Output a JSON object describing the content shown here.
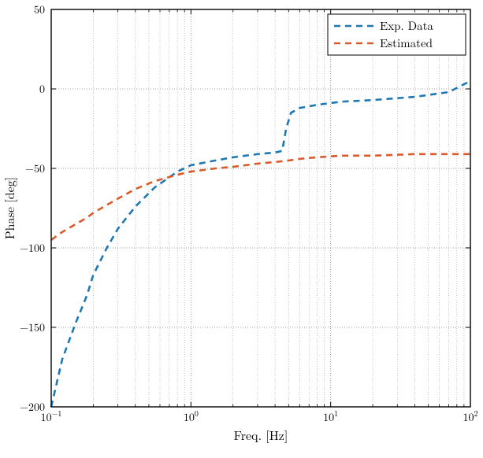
{
  "chart_data": {
    "type": "line",
    "xlabel": "Freq. [Hz]",
    "ylabel": "Phase [deg]",
    "xscale": "log",
    "xlim": [
      0.1,
      100
    ],
    "ylim": [
      -200,
      50
    ],
    "xticks_major": [
      0.1,
      1,
      10,
      100
    ],
    "xtick_labels": [
      "10^-1",
      "10^0",
      "10^1",
      "10^2"
    ],
    "yticks_major": [
      -200,
      -150,
      -100,
      -50,
      0,
      50
    ],
    "grid": true,
    "legend_position": "top-right",
    "series": [
      {
        "name": "Exp. Data",
        "color": "#1f77b4",
        "dash": "8,6",
        "x": [
          0.1,
          0.12,
          0.15,
          0.18,
          0.2,
          0.25,
          0.3,
          0.4,
          0.55,
          0.8,
          1.0,
          1.5,
          2.0,
          3.0,
          4.0,
          4.5,
          4.8,
          5.2,
          6.0,
          8.0,
          12,
          20,
          40,
          70,
          100
        ],
        "y": [
          -200,
          -170,
          -147,
          -130,
          -117,
          -100,
          -88,
          -74,
          -62,
          -52,
          -48,
          -45,
          -43,
          -41,
          -40,
          -39,
          -25,
          -15,
          -12,
          -10,
          -8,
          -7,
          -5,
          -2,
          5
        ]
      },
      {
        "name": "Estimated",
        "color": "#d95a2b",
        "dash": "8,6",
        "x": [
          0.1,
          0.12,
          0.15,
          0.18,
          0.2,
          0.25,
          0.3,
          0.4,
          0.55,
          0.8,
          1.0,
          1.5,
          2.0,
          3.0,
          4.0,
          5.0,
          6.0,
          8.0,
          12,
          20,
          40,
          70,
          100
        ],
        "y": [
          -95,
          -90,
          -85,
          -81,
          -78,
          -73,
          -69,
          -63,
          -58,
          -54,
          -52,
          -50,
          -49,
          -47,
          -46,
          -45,
          -44,
          -43,
          -42,
          -42,
          -41,
          -41,
          -41
        ]
      }
    ]
  }
}
